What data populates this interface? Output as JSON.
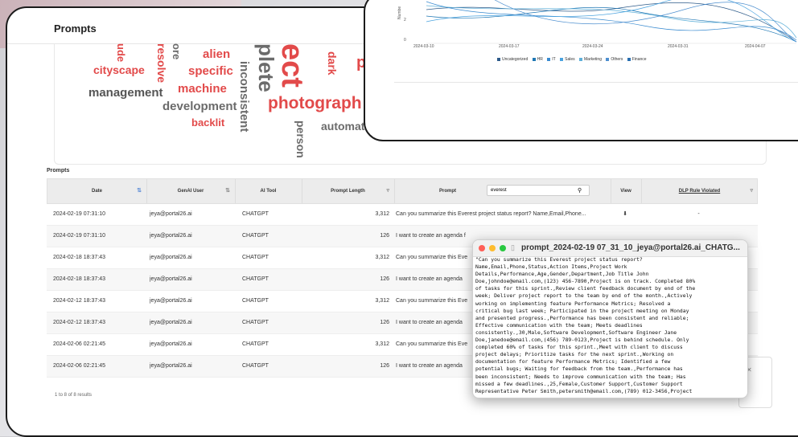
{
  "page": {
    "title": "Prompts"
  },
  "wordcloud": [
    {
      "t": "alien",
      "c": "red"
    },
    {
      "t": "cityscape",
      "c": "red"
    },
    {
      "t": "specific",
      "c": "red"
    },
    {
      "t": "machine",
      "c": "red"
    },
    {
      "t": "management",
      "c": "gray"
    },
    {
      "t": "development",
      "c": "gray"
    },
    {
      "t": "backlit",
      "c": "red"
    },
    {
      "t": "photograph",
      "c": "red"
    },
    {
      "t": "automatic",
      "c": "gray"
    },
    {
      "t": "inconsistent",
      "c": "gray"
    },
    {
      "t": "resolve",
      "c": "red"
    },
    {
      "t": "dark",
      "c": "red"
    },
    {
      "t": "person",
      "c": "gray"
    },
    {
      "t": "plete",
      "c": "gray"
    },
    {
      "t": "ect",
      "c": "red"
    },
    {
      "t": "ore",
      "c": "gray"
    },
    {
      "t": "ude",
      "c": "red"
    },
    {
      "t": "pr",
      "c": "red"
    }
  ],
  "table": {
    "title": "Prompts",
    "columns": {
      "date": "Date",
      "user": "GenAI User",
      "tool": "AI Tool",
      "length": "Prompt Length",
      "prompt": "Prompt",
      "view": "View",
      "dlp": "DLP Rule Violated"
    },
    "search_value": "everest",
    "rows": [
      {
        "date": "2024-02-19 07:31:10",
        "user": "jeya@portal26.ai",
        "tool": "CHATGPT",
        "length": "3,312",
        "prompt": "Can you summarize this Everest project status report? Name,Email,Phone...",
        "view": "⬇",
        "dlp": "-"
      },
      {
        "date": "2024-02-19 07:31:10",
        "user": "jeya@portal26.ai",
        "tool": "CHATGPT",
        "length": "126",
        "prompt": "I want to create an agenda f",
        "view": "",
        "dlp": ""
      },
      {
        "date": "2024-02-18 18:37:43",
        "user": "jeya@portal26.ai",
        "tool": "CHATGPT",
        "length": "3,312",
        "prompt": "Can you summarize this Eve",
        "view": "",
        "dlp": ""
      },
      {
        "date": "2024-02-18 18:37:43",
        "user": "jeya@portal26.ai",
        "tool": "CHATGPT",
        "length": "126",
        "prompt": "I want to create an agenda",
        "view": "",
        "dlp": ""
      },
      {
        "date": "2024-02-12 18:37:43",
        "user": "jeya@portal26.ai",
        "tool": "CHATGPT",
        "length": "3,312",
        "prompt": "Can you summarize this Eve",
        "view": "",
        "dlp": ""
      },
      {
        "date": "2024-02-12 18:37:43",
        "user": "jeya@portal26.ai",
        "tool": "CHATGPT",
        "length": "126",
        "prompt": "I want to create an agenda",
        "view": "",
        "dlp": ""
      },
      {
        "date": "2024-02-06 02:21:45",
        "user": "jeya@portal26.ai",
        "tool": "CHATGPT",
        "length": "3,312",
        "prompt": "Can you summarize this Eve",
        "view": "",
        "dlp": ""
      },
      {
        "date": "2024-02-06 02:21:45",
        "user": "jeya@portal26.ai",
        "tool": "CHATGPT",
        "length": "126",
        "prompt": "I want to create an agenda",
        "view": "",
        "dlp": ""
      }
    ],
    "results_text": "1 to 8 of 8 results"
  },
  "chart": {
    "y_axis_label": "Numbe",
    "y_ticks": [
      "2",
      "0"
    ],
    "x_ticks": [
      "2024-03-10",
      "2024-03-17",
      "2024-03-24",
      "2024-03-31",
      "2024-04-07"
    ],
    "legend": [
      {
        "name": "Uncategorized",
        "color": "#2e5b8a"
      },
      {
        "name": "HR",
        "color": "#1f77b4"
      },
      {
        "name": "IT",
        "color": "#3a8bd0"
      },
      {
        "name": "Sales",
        "color": "#4aa3df"
      },
      {
        "name": "Marketing",
        "color": "#5fb0d9"
      },
      {
        "name": "Others",
        "color": "#4d8fcf"
      },
      {
        "name": "Finance",
        "color": "#2a6fb0"
      }
    ]
  },
  "popup": {
    "title": "prompt_2024-02-19 07_31_10_jeya@portal26.ai_CHATG...",
    "body": "\"Can you summarize this Everest project status report?\nName,Email,Phone,Status,Action Items,Project Work\nDetails,Performance,Age,Gender,Department,Job Title John\nDoe,johndoe@email.com,(123) 456-7890,Project is on track. Completed 80%\nof tasks for this sprint.,Review client feedback document by end of the\nweek; Deliver project report to the team by end of the month.,Actively\nworking on implementing feature Performance Metrics; Resolved a\ncritical bug last week; Participated in the project meeting on Monday\nand presented progress.,Performance has been consistent and reliable;\nEffective communication with the team; Meets deadlines\nconsistently.,30,Male,Software Development,Software Engineer Jane\nDoe,janedoe@email.com,(456) 789-0123,Project is behind schedule. Only\ncompleted 60% of tasks for this sprint.,Meet with client to discuss\nproject delays; Prioritize tasks for the next sprint.,Working on\ndocumentation for feature Performance Metrics; Identified a few\npotential bugs; Waiting for feedback from the team.,Performance has\nbeen inconsistent; Needs to improve communication with the team; Has\nmissed a few deadlines.,25,Female,Customer Support,Customer Support\nRepresentative Peter Smith,petersmith@email.com,(789) 012-3456,Project"
  }
}
